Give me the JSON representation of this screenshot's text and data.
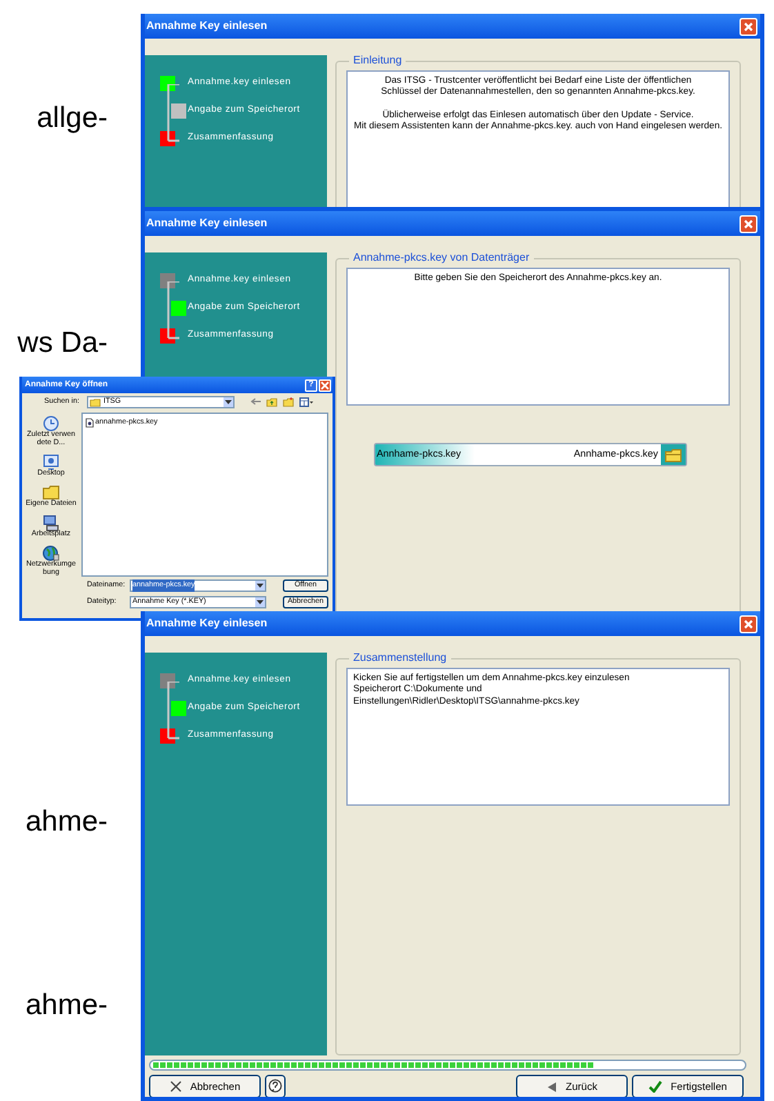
{
  "page_text": [
    "allge-",
    "ws Da-",
    "ahme-",
    "ahme-"
  ],
  "windows": [
    {
      "title": "Annahme Key einlesen",
      "steps": [
        {
          "label": "Annahme.key einlesen",
          "color": "#00ff00"
        },
        {
          "label": "Angabe zum Speicherort",
          "color": "#c0c0c0"
        },
        {
          "label": "Zusammenfassung",
          "color": "#ff0000"
        }
      ],
      "section": {
        "legend": "Einleitung",
        "centered": true,
        "paragraphs": [
          [
            "Das ITSG  - Trustcenter veröffentlicht bei Bedarf eine Liste der öffentlichen",
            "Schlüssel der Datenannahmestellen, den so genannten Annahme-pkcs.key."
          ],
          [
            "Üblicherweise erfolgt das Einlesen automatisch über den Update - Service.",
            "Mit diesem Assistenten kann der Annahme-pkcs.key. auch von Hand eingelesen werden."
          ]
        ]
      }
    },
    {
      "title": "Annahme Key einlesen",
      "steps": [
        {
          "label": "Annahme.key einlesen",
          "color": "#808080"
        },
        {
          "label": "Angabe zum Speicherort",
          "color": "#00ff00"
        },
        {
          "label": "Zusammenfassung",
          "color": "#ff0000"
        }
      ],
      "section": {
        "legend": "Annahme-pkcs.key von Datenträger",
        "centered": true,
        "paragraphs": [
          [
            "Bitte geben Sie den Speicherort des Annahme-pkcs.key an."
          ]
        ],
        "key_field": {
          "label": "Annhame-pkcs.key",
          "value": "Annhame-pkcs.key"
        }
      }
    },
    {
      "title": "Annahme Key einlesen",
      "steps": [
        {
          "label": "Annahme.key einlesen",
          "color": "#808080"
        },
        {
          "label": "Angabe zum Speicherort",
          "color": "#00ff00"
        },
        {
          "label": "Zusammenfassung",
          "color": "#ff0000"
        }
      ],
      "section": {
        "legend": "Zusammenstellung",
        "centered": false,
        "paragraphs": [
          [
            "Kicken Sie auf fertigstellen um dem Annahme-pkcs.key einzulesen",
            "Speicherort C:\\Dokumente und",
            "Einstellungen\\Ridler\\Desktop\\ITSG\\annahme-pkcs.key"
          ]
        ]
      },
      "progress": {
        "level": 0.75
      },
      "buttons": [
        {
          "kind": "cancel",
          "label": "Abbrechen"
        },
        {
          "kind": "help"
        },
        {
          "kind": "back",
          "label": "Zurück"
        },
        {
          "kind": "finish",
          "label": "Fertigstellen"
        }
      ]
    }
  ],
  "file_dialog": {
    "title": "Annahme Key öffnen",
    "help_button": "?",
    "look_in_label": "Suchen in:",
    "look_in_value": "ITSG",
    "places": [
      {
        "kind": "recent",
        "label": "Zuletzt verwendete D..."
      },
      {
        "kind": "desktop",
        "label": "Desktop"
      },
      {
        "kind": "documents",
        "label": "Eigene Dateien"
      },
      {
        "kind": "computer",
        "label": "Arbeitsplatz"
      },
      {
        "kind": "network",
        "label": "Netzwerkumgebung"
      }
    ],
    "files": [
      "annahme-pkcs.key"
    ],
    "filename_label": "Dateiname:",
    "filename_value": "annahme-pkcs.key",
    "filename_selected": true,
    "filetype_label": "Dateityp:",
    "filetype_value": "Annahme Key (*.KEY)",
    "open_button": "Öffnen",
    "cancel_button": "Abbrechen"
  }
}
